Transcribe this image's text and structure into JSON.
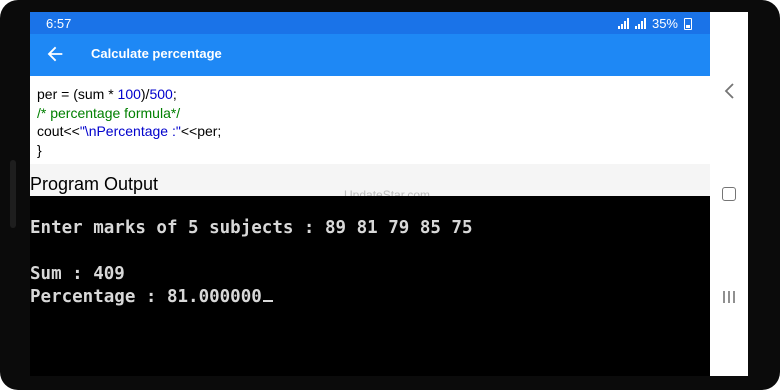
{
  "status_bar": {
    "time": "6:57",
    "battery": "35%"
  },
  "app_bar": {
    "title": "Calculate percentage",
    "back_icon": "arrow-left-icon"
  },
  "code_lines": [
    {
      "a": "per = (sum * ",
      "b": "100",
      "c": ")/",
      "d": "500",
      "e": ";"
    },
    {
      "comment": "/* percentage formula*/"
    },
    {
      "a": "cout<<",
      "str": "\"\\nPercentage :\"",
      "c": "<<per;"
    },
    {
      "a": "}"
    }
  ],
  "section_heading": "Program Output",
  "watermark": "UpdateStar.com",
  "console_output": [
    "Enter marks of 5 subjects : 89 81 79 85 75",
    "Sum : 409",
    "Percentage : 81.000000"
  ],
  "nav_bar": {
    "back": "triangle-back-icon",
    "home": "square-home-icon",
    "recents": "recents-icon"
  },
  "colors": {
    "app_bar": "#1e88f5",
    "status_bar": "#1a73e8",
    "comment": "#008000",
    "keyword_number": "#0000cc"
  }
}
